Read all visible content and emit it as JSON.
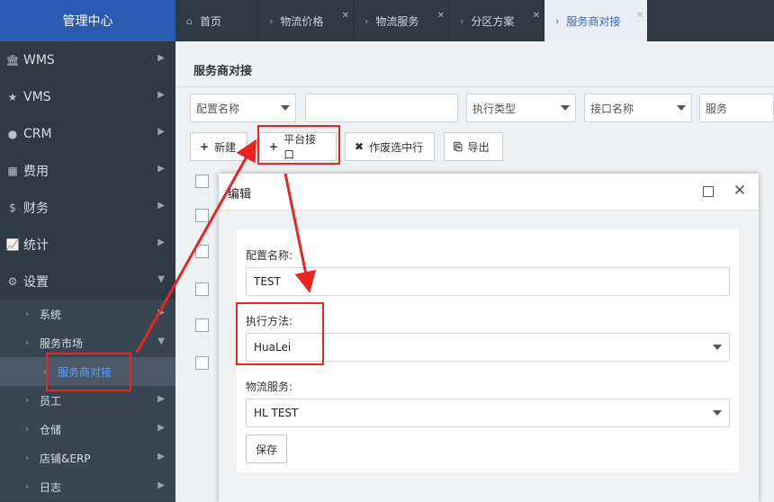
{
  "sidebar": {
    "brand": "管理中心",
    "items": [
      {
        "label": "WMS",
        "icon": "bank-icon"
      },
      {
        "label": "VMS",
        "icon": "star-icon"
      },
      {
        "label": "CRM",
        "icon": "user-icon"
      },
      {
        "label": "费用",
        "icon": "table-icon"
      },
      {
        "label": "财务",
        "icon": "dollar-icon"
      },
      {
        "label": "统计",
        "icon": "chart-icon"
      },
      {
        "label": "设置",
        "icon": "gear-icon"
      }
    ],
    "sub": [
      {
        "label": "系统"
      },
      {
        "label": "服务市场"
      },
      {
        "label": "服务商对接"
      },
      {
        "label": "员工"
      },
      {
        "label": "仓储"
      },
      {
        "label": "店铺&ERP"
      },
      {
        "label": "日志"
      }
    ]
  },
  "tabs": [
    {
      "label": "首页"
    },
    {
      "label": "物流价格"
    },
    {
      "label": "物流服务"
    },
    {
      "label": "分区方案"
    },
    {
      "label": "服务商对接"
    }
  ],
  "main": {
    "title": "服务商对接",
    "filters": {
      "config_name": "配置名称",
      "exec_type": "执行类型",
      "api_name": "接口名称",
      "service": "服务"
    },
    "buttons": {
      "new": "新建",
      "platform_api": "平台接口",
      "void_selected": "作废选中行",
      "export": "导出"
    }
  },
  "modal": {
    "title": "编辑",
    "fields": {
      "config_name_label": "配置名称:",
      "config_name_value": "TEST",
      "exec_method_label": "执行方法:",
      "exec_method_value": "HuaLei",
      "logistics_service_label": "物流服务:",
      "logistics_service_value": "HL TEST"
    },
    "save": "保存"
  },
  "colors": {
    "sidebar_bg": "#2f3a45",
    "brand_bg": "#2a5bb3",
    "accent": "#2a6acb",
    "annotation": "#e8261f"
  }
}
